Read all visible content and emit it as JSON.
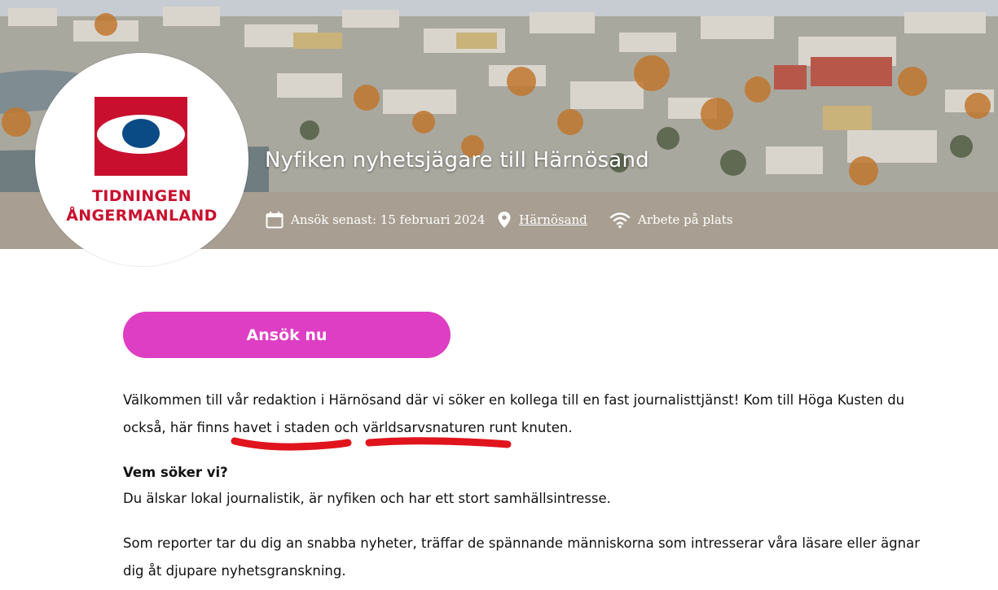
{
  "job": {
    "title": "Nyfiken nyhetsjägare till Härnösand",
    "deadline": "Ansök senast: 15 februari 2024",
    "location": "Härnösand",
    "work_type": "Arbete på plats"
  },
  "company": {
    "name_line1": "TIDNINGEN",
    "name_line2": "ÅNGERMANLAND"
  },
  "apply_label": "Ansök nu",
  "description": {
    "intro_line1": "Välkommen till vår redaktion i Härnösand där vi söker en kollega till en fast journalisttjänst! Kom till Höga Kusten du",
    "intro_line2": "också, här finns havet i staden och världsarvsnaturen runt knuten.",
    "who_heading": "Vem söker vi?",
    "who_text": "Du älskar lokal journalistik, är nyfiken och har ett stort samhällsintresse.",
    "reporter_line1": "Som reporter tar du dig an snabba nyheter, träffar de spännande människorna som intresserar våra läsare eller ägnar",
    "reporter_line2": "dig åt djupare nyhetsgranskning."
  },
  "icons": {
    "deadline": "calendar-icon",
    "location": "location-pin-icon",
    "work_type": "wifi-icon"
  },
  "colors": {
    "meta_bar": "#a89e91",
    "apply_button": "#de3ec3",
    "brand_red": "#c8102e",
    "brand_blue": "#0a4b86",
    "annotation_red": "#e0141c"
  }
}
